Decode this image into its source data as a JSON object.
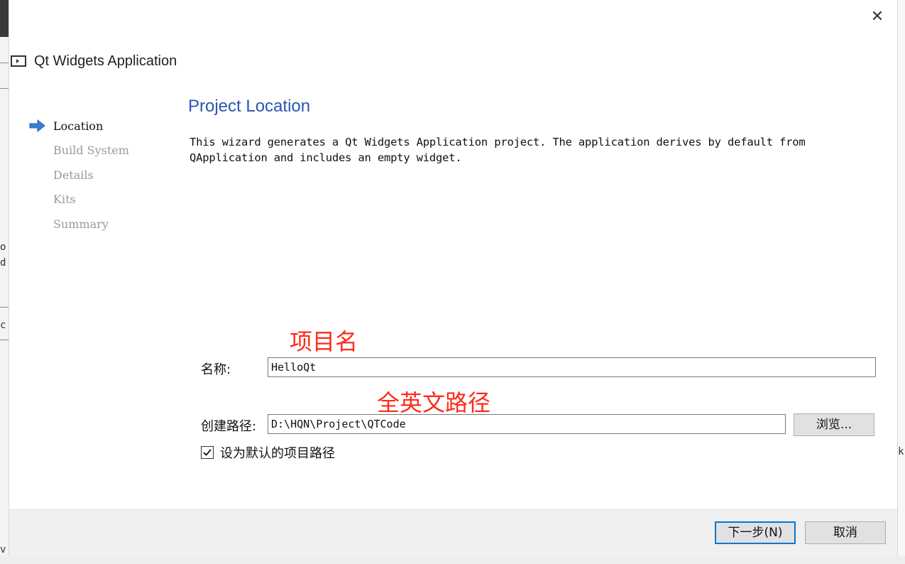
{
  "dialog": {
    "title": "Qt Widgets Application",
    "close_glyph": "✕"
  },
  "steps": [
    {
      "label": "Location",
      "active": true
    },
    {
      "label": "Build System",
      "active": false
    },
    {
      "label": "Details",
      "active": false
    },
    {
      "label": "Kits",
      "active": false
    },
    {
      "label": "Summary",
      "active": false
    }
  ],
  "page": {
    "title": "Project Location",
    "description_line1": "This wizard generates a Qt Widgets Application project. The application derives by default from",
    "description_line2": "QApplication and includes an empty widget."
  },
  "annotations": {
    "name_note": "项目名",
    "path_note": "全英文路径"
  },
  "form": {
    "name_label": "名称:",
    "name_value": "HelloQt",
    "path_label": "创建路径:",
    "path_value": "D:\\HQN\\Project\\QTCode",
    "browse_label": "浏览...",
    "default_path_checked": true,
    "default_path_label": "设为默认的项目路径"
  },
  "footer": {
    "next_label": "下一步(N)",
    "cancel_label": "取消"
  },
  "background_fragments": {
    "left_a": "o",
    "left_b": "d",
    "left_c": "c",
    "right_a": "k",
    "bottom_left": "v"
  },
  "colors": {
    "title_blue": "#2a55b0",
    "annotation_red": "#ff2a1a",
    "primary_border": "#0078d7",
    "step_arrow": "#3a7fd5"
  }
}
